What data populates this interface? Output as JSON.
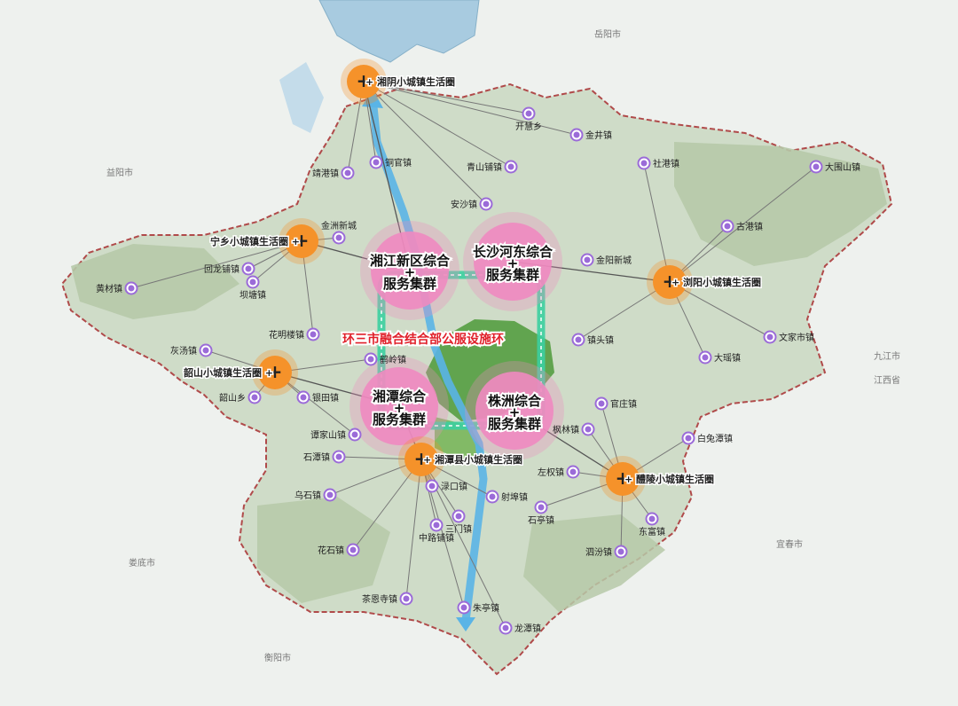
{
  "colors": {
    "background": "#eef1ee",
    "region_fill": "#cfdcc8",
    "region_border": "#b04a4a",
    "mountain": "#b6c9a8",
    "lake": "#a8cbe0",
    "river": "#5ab4e6",
    "cluster": "#f08ac0",
    "hub": "#f5922a",
    "town": "#9b6bd8",
    "ring": "#3ccfa0",
    "green_core": "#4e9a3a",
    "link": "#777777",
    "ring_text": "#e0202a"
  },
  "ring_label": "环三市融合结合部公服设施环",
  "clusters": [
    {
      "id": "xiangjiang",
      "line1": "湘江新区综合",
      "line2": "服务集群"
    },
    {
      "id": "changsha",
      "line1": "长沙河东综合",
      "line2": "服务集群"
    },
    {
      "id": "xiangtan",
      "line1": "湘潭综合",
      "line2": "服务集群"
    },
    {
      "id": "zhuzhou",
      "line1": "株洲综合",
      "line2": "服务集群"
    }
  ],
  "hubs": [
    {
      "id": "xiangyin",
      "label": "湘阴小城镇生活圈"
    },
    {
      "id": "ningxiang",
      "label": "宁乡小城镇生活圈"
    },
    {
      "id": "liuyang",
      "label": "浏阳小城镇生活圈"
    },
    {
      "id": "shaoshan",
      "label": "韶山小城镇生活圈"
    },
    {
      "id": "xiangtanxian",
      "label": "湘潭县小城镇生活圈"
    },
    {
      "id": "liling",
      "label": "醴陵小城镇生活圈"
    }
  ],
  "towns": [
    "开慧乡",
    "金井镇",
    "社港镇",
    "大围山镇",
    "古港镇",
    "文家市镇",
    "大瑶镇",
    "镇头镇",
    "金阳新城",
    "安沙镇",
    "青山铺镇",
    "靖港镇",
    "铜官镇",
    "金洲新城",
    "回龙铺镇",
    "黄材镇",
    "坝塘镇",
    "花明楼镇",
    "灰汤镇",
    "韶山乡",
    "银田镇",
    "鹤岭镇",
    "谭家山镇",
    "石潭镇",
    "乌石镇",
    "花石镇",
    "茶恩寺镇",
    "中路铺镇",
    "三门镇",
    "朱亭镇",
    "龙潭镇",
    "渌口镇",
    "石亭镇",
    "左权镇",
    "泗汾镇",
    "东富镇",
    "白兔潭镇",
    "官庄镇",
    "枫林镇",
    "射埠镇"
  ],
  "basemap": [
    "岳阳市",
    "益阳市",
    "娄底市",
    "衡阳市",
    "宜春市",
    "九江市",
    "江西省"
  ]
}
